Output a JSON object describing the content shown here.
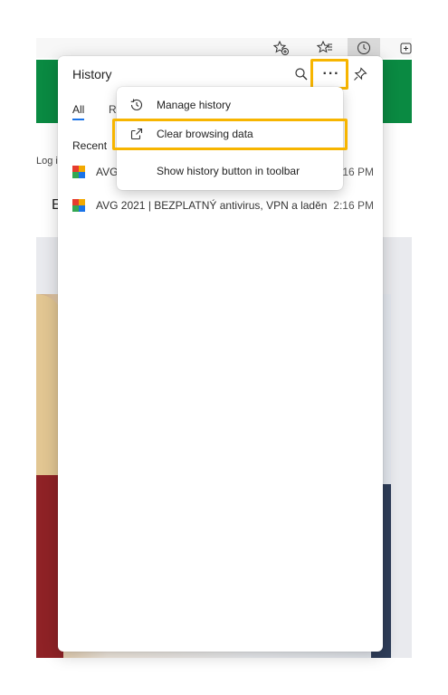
{
  "browser": {
    "toolbar_icons": [
      "add-favorite-icon",
      "favorites-icon",
      "history-icon",
      "collections-icon"
    ],
    "background": {
      "partial_login": "Log in",
      "partial_heading": "E"
    }
  },
  "history_panel": {
    "title": "History",
    "tabs": [
      {
        "label": "All",
        "selected": true
      },
      {
        "label": "Re",
        "selected": false
      }
    ],
    "section_label": "Recent",
    "items": [
      {
        "title": "AVG",
        "time": "16 PM",
        "favicon": "avg-favicon"
      },
      {
        "title": "AVG 2021 | BEZPLATNÝ antivirus, VPN a ladění ...",
        "time": "2:16 PM",
        "favicon": "avg-favicon"
      }
    ],
    "toolbar": {
      "search": "search-icon",
      "more": "···",
      "pin": "pin-icon"
    }
  },
  "more_menu": {
    "items": [
      {
        "label": "Manage history",
        "icon": "history-icon"
      },
      {
        "label": "Clear browsing data",
        "icon": "open-external-icon"
      },
      {
        "label": "Show history button in toolbar",
        "icon": ""
      }
    ]
  },
  "highlight_color": "#f7b500",
  "accent_color": "#0a8a42"
}
